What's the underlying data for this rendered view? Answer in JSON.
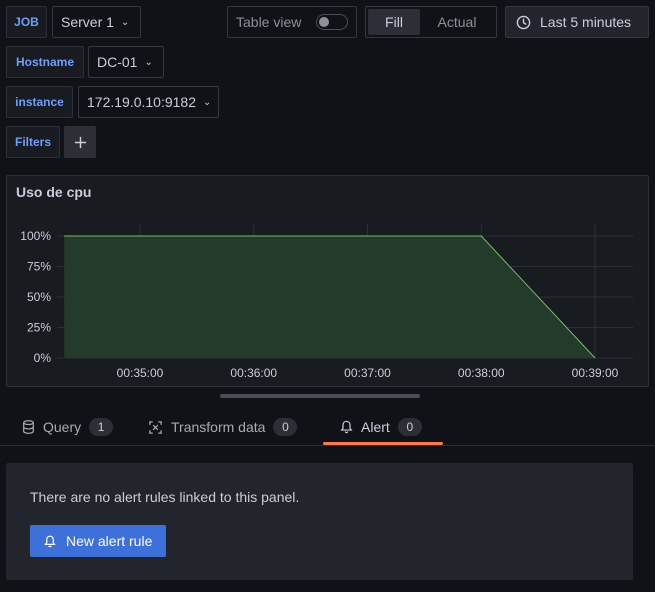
{
  "variables": {
    "job": {
      "label": "JOB",
      "value": "Server 1"
    },
    "hostname": {
      "label": "Hostname",
      "value": "DC-01"
    },
    "instance": {
      "label": "instance",
      "value": "172.19.0.10:9182"
    },
    "filters": {
      "label": "Filters",
      "add_icon": "plus-icon"
    }
  },
  "toolbar": {
    "table_view_label": "Table view",
    "table_view_on": false,
    "fill_label": "Fill",
    "actual_label": "Actual",
    "fill_selected": true,
    "time_range_label": "Last 5 minutes"
  },
  "panel": {
    "title": "Uso de cpu",
    "series_color": "#73bf69",
    "fill_color": "#243a2a"
  },
  "chart_data": {
    "type": "area",
    "x_ticks": [
      "00:35:00",
      "00:36:00",
      "00:37:00",
      "00:38:00",
      "00:39:00"
    ],
    "y_ticks": [
      "100%",
      "75%",
      "50%",
      "25%",
      "0%"
    ],
    "ylim": [
      0,
      100
    ],
    "x": [
      "00:34:20",
      "00:38:00",
      "00:39:00"
    ],
    "values": [
      100,
      100,
      0
    ],
    "grid": true
  },
  "tabs": [
    {
      "label": "Query",
      "count": "1",
      "icon": "database-icon"
    },
    {
      "label": "Transform data",
      "count": "0",
      "icon": "transform-icon"
    },
    {
      "label": "Alert",
      "count": "0",
      "icon": "bell-icon",
      "active": true
    }
  ],
  "alert": {
    "empty_message": "There are no alert rules linked to this panel.",
    "new_rule_label": "New alert rule"
  },
  "colors": {
    "accent": "#3d71d9",
    "active_tab": "#ff7a45",
    "label_blue": "#6e9fff"
  }
}
